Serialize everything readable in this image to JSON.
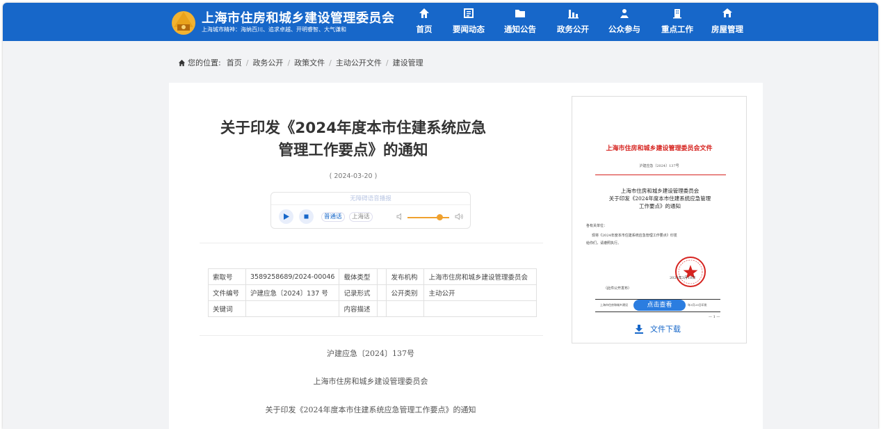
{
  "site": {
    "title": "上海市住房和城乡建设管理委员会",
    "slogan": "上海城市精神：海纳百川、追求卓越、开明睿智、大气谦和",
    "logo_icon": "shanghai-emblem-icon"
  },
  "nav": [
    {
      "label": "首页",
      "icon": "home-icon"
    },
    {
      "label": "要闻动态",
      "icon": "news-icon"
    },
    {
      "label": "通知公告",
      "icon": "folder-icon"
    },
    {
      "label": "政务公开",
      "icon": "bar-chart-icon"
    },
    {
      "label": "公众参与",
      "icon": "people-icon"
    },
    {
      "label": "重点工作",
      "icon": "building-icon"
    },
    {
      "label": "房屋管理",
      "icon": "house-icon"
    }
  ],
  "breadcrumb": {
    "prefix": "您的位置:",
    "items": [
      "首页",
      "政务公开",
      "政策文件",
      "主动公开文件",
      "建设管理"
    ]
  },
  "article": {
    "title_line1": "关于印发《2024年度本市住建系统应急",
    "title_line2": "管理工作要点》的通知",
    "date": "( 2024-03-20 )"
  },
  "player": {
    "header": "无障碍语音播报",
    "lang_active": "普通话",
    "lang_other": "上海话",
    "volume": 0.8
  },
  "meta_table": [
    [
      "索取号",
      "3589258689/2024-00046",
      "载体类型",
      "",
      "发布机构",
      "上海市住房和城乡建设管理委员会"
    ],
    [
      "文件编号",
      "沪建应急〔2024〕137 号",
      "记录形式",
      "",
      "公开类别",
      "主动公开"
    ],
    [
      "关键词",
      "",
      "内容描述",
      "",
      "",
      ""
    ]
  ],
  "body": {
    "line1": "沪建应急〔2024〕137号",
    "line2": "上海市住房和城乡建设管理委员会",
    "line3": "关于印发《2024年度本市住建系统应急管理工作要点》的通知"
  },
  "preview": {
    "header": "上海市住房和城乡建设管理委员会文件",
    "doc_number": "沪建应急〔2024〕137号",
    "title_line1": "上海市住房和城乡建设管理委员会",
    "title_line2": "关于印发《2024年度本市住建系统应急管理",
    "title_line3": "工作要点》的通知",
    "addressee": "各有关单位：",
    "body_line1": "现将《2024年度本市住建系统应急管理工作要点》印发",
    "body_line2": "给你们，请遵照执行。",
    "date": "2024年3月18日",
    "public_note": "（此件公开发布）",
    "footer_left": "上海市住房和城乡建设",
    "footer_right": "年3月20日印发",
    "page_num": "— 1 —",
    "view_button": "点击查看",
    "download_label": "文件下载",
    "colors": {
      "red": "#d6231f",
      "blue": "#2b7de0"
    }
  },
  "colors": {
    "header_bg": "#1767c9",
    "accent": "#1767c9",
    "volume": "#f0a12e"
  }
}
